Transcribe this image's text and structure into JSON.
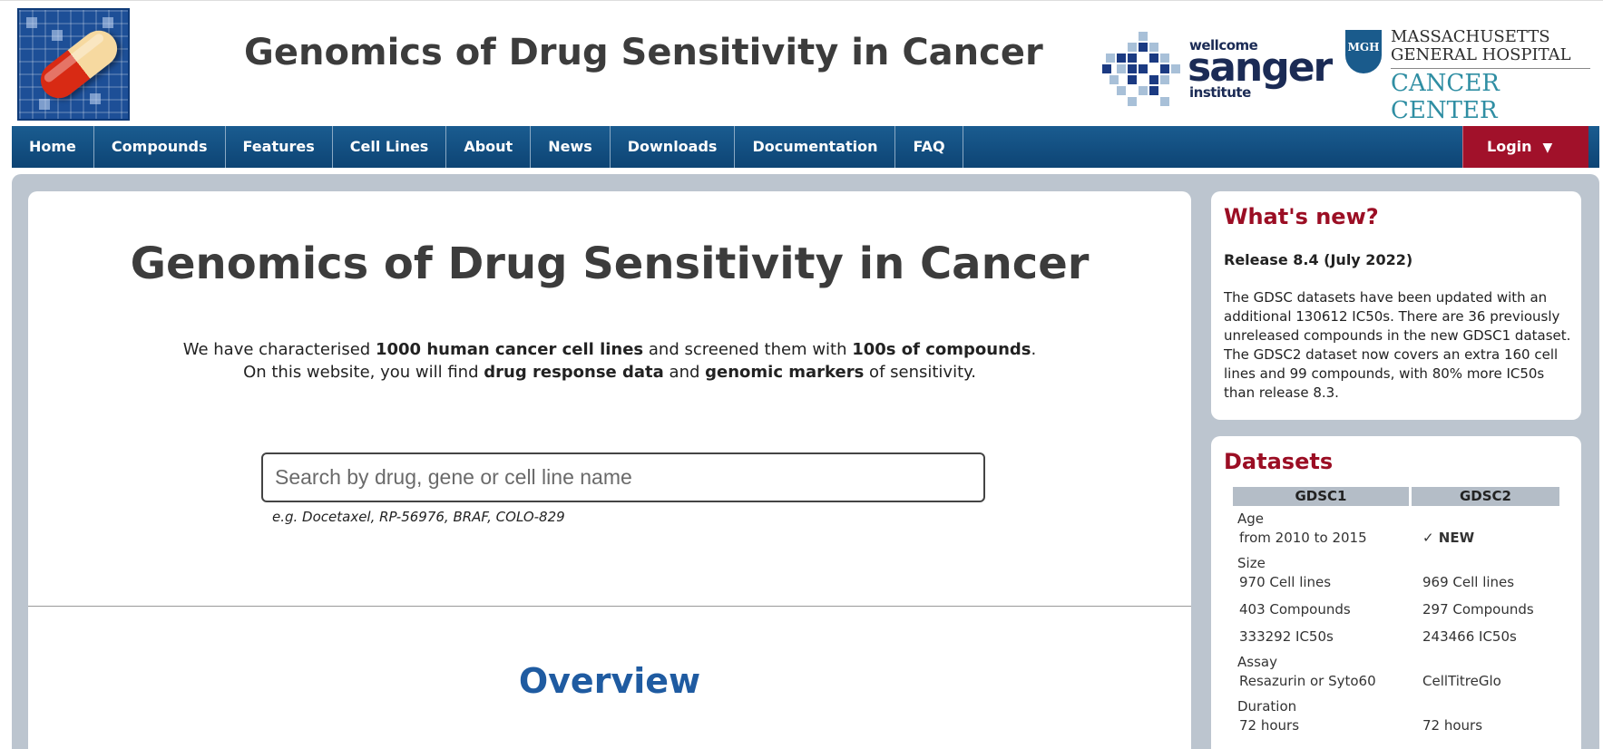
{
  "header": {
    "title": "Genomics of Drug Sensitivity in Cancer",
    "logo_icon": "pill-capsule-icon",
    "sanger": {
      "line1": "wellcome",
      "line2": "sanger",
      "line3": "institute"
    },
    "mgh": {
      "badge": "MGH",
      "line1": "MASSACHUSETTS",
      "line2": "GENERAL HOSPITAL",
      "line3": "CANCER CENTER"
    }
  },
  "nav": {
    "items": [
      "Home",
      "Compounds",
      "Features",
      "Cell Lines",
      "About",
      "News",
      "Downloads",
      "Documentation",
      "FAQ"
    ],
    "login": "Login",
    "login_caret": "▼"
  },
  "main": {
    "heading": "Genomics of Drug Sensitivity in Cancer",
    "intro": {
      "p1a": "We have characterised ",
      "p1b": "1000 human cancer cell lines",
      "p1c": " and screened them with ",
      "p1d": "100s of compounds",
      "p1e": ".",
      "p2a": "On this website, you will find ",
      "p2b": "drug response data",
      "p2c": " and ",
      "p2d": "genomic markers",
      "p2e": " of sensitivity."
    },
    "search_placeholder": "Search by drug, gene or cell line name",
    "search_example": "e.g. Docetaxel, RP-56976, BRAF, COLO-829",
    "overview": "Overview"
  },
  "whats_new": {
    "title": "What's new?",
    "release": "Release 8.4 (July 2022)",
    "text": "The GDSC datasets have been updated with an additional 130612 IC50s. There are 36 previously unreleased compounds in the new GDSC1 dataset. The GDSC2 dataset now covers an extra 160 cell lines and 99 compounds, with 80% more IC50s than release 8.3."
  },
  "datasets": {
    "title": "Datasets",
    "col1": "GDSC1",
    "col2": "GDSC2",
    "age_label": "Age",
    "age_v1": "from 2010 to 2015",
    "age_v2": "✓ NEW",
    "size_label": "Size",
    "cells_v1": "970 Cell lines",
    "cells_v2": "969 Cell lines",
    "compounds_v1": "403 Compounds",
    "compounds_v2": "297 Compounds",
    "ic50_v1": "333292 IC50s",
    "ic50_v2": "243466 IC50s",
    "assay_label": "Assay",
    "assay_v1": "Resazurin or Syto60",
    "assay_v2": "CellTitreGlo",
    "duration_label": "Duration",
    "duration_v1": "72 hours",
    "duration_v2": "72 hours"
  },
  "colors": {
    "nav": "#0d4474",
    "login": "#a1112a",
    "heading_red": "#9b0e24",
    "overview_blue": "#1f5ba1",
    "panel": "#bcc5cf"
  }
}
